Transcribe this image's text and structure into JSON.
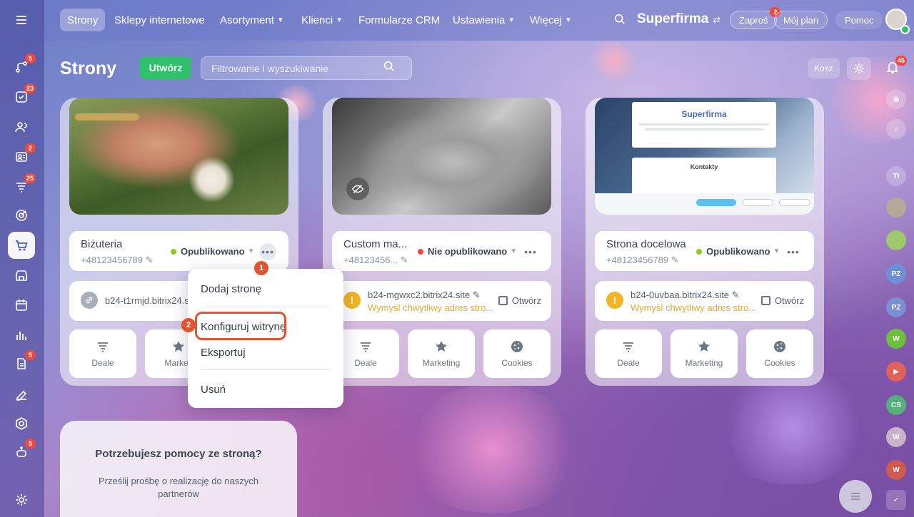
{
  "topnav": {
    "tabs": [
      {
        "label": "Strony",
        "active": true
      },
      {
        "label": "Sklepy internetowe"
      },
      {
        "label": "Asortyment"
      },
      {
        "label": "Klienci"
      },
      {
        "label": "Formularze CRM"
      },
      {
        "label": "Ustawienia"
      },
      {
        "label": "Więcej"
      }
    ],
    "brand": "Superfirma",
    "invite_label": "Zaproś",
    "invite_badge": "2",
    "plan_label": "Mój plan",
    "help_label": "Pomoc"
  },
  "sidebar": {
    "badges": [
      "5",
      "23",
      "2",
      "25",
      "5",
      "5"
    ]
  },
  "header": {
    "title": "Strony",
    "create_label": "Utwórz",
    "search_placeholder": "Filtrowanie i wyszukiwanie",
    "trash_label": "Kosz",
    "notifications_badge": "45"
  },
  "cards": [
    {
      "name": "Biżuteria",
      "phone": "+48123456789",
      "status": "Opublikowano",
      "status_color": "#8ac926",
      "domain": "b24-t1rmjd.bitrix24.s",
      "actions": [
        "Deale",
        "Marketi",
        ""
      ]
    },
    {
      "name": "Custom ma...",
      "phone": "+48123456...",
      "status": "Nie opublikowano",
      "status_color": "#f0483e",
      "domain": "b24-mgwxc2.bitrix24.site",
      "warning": "Wymyśl chwytliwy adres stro...",
      "open_label": "Otwórz",
      "actions": [
        "Deale",
        "Marketing",
        "Cookies"
      ]
    },
    {
      "name": "Strona docelowa",
      "phone": "+48123456789",
      "status": "Opublikowano",
      "status_color": "#8ac926",
      "domain": "b24-0uvbaa.bitrix24.site",
      "warning": "Wymyśl chwytliwy adres stro...",
      "open_label": "Otwórz",
      "actions": [
        "Deale",
        "Marketing",
        "Cookies"
      ],
      "preview_title": "Superfirma",
      "preview_contacts": "Kontakty"
    }
  ],
  "menu": {
    "items": [
      "Dodaj stronę",
      "Konfiguruj witrynę",
      "Eksportuj",
      "Usuń"
    ],
    "step1": "1",
    "step2": "2"
  },
  "help": {
    "title": "Potrzebujesz pomocy ze stroną?",
    "text": "Prześlij prośbę o realizację do naszych partnerów"
  },
  "rail": {
    "avatars": [
      "TI",
      "PZ",
      "PZ",
      "W",
      "CS",
      "W",
      "W"
    ]
  },
  "colors": {
    "accent_green": "#2fc26b",
    "highlight": "#e0552f",
    "warning": "#e8a72a"
  }
}
